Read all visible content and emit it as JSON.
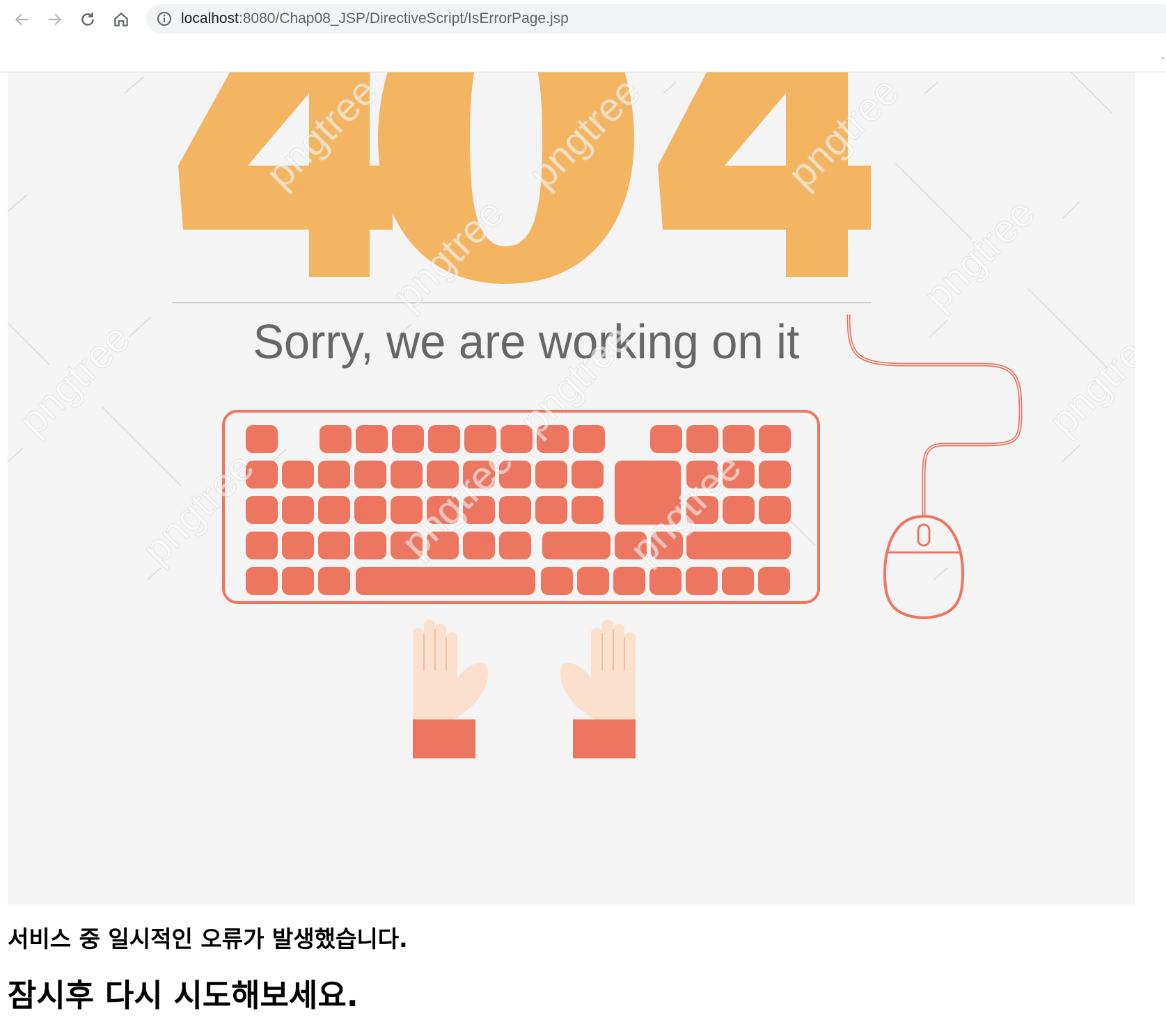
{
  "browser": {
    "url_host": "localhost",
    "url_path": ":8080/Chap08_JSP/DirectiveScript/IsErrorPage.jsp"
  },
  "image": {
    "big_text": "404",
    "caption": "Sorry, we are working on it",
    "watermark": "pngtree"
  },
  "messages": {
    "line1": "서비스 중 일시적인 오류가 발생했습니다.",
    "line2": "잠시후 다시 시도해보세요."
  },
  "colors": {
    "digits": "#f3b562",
    "keys": "#ec7660",
    "hand": "#fbe1cd",
    "caption": "#666666",
    "image_bg": "#f4f4f4"
  }
}
